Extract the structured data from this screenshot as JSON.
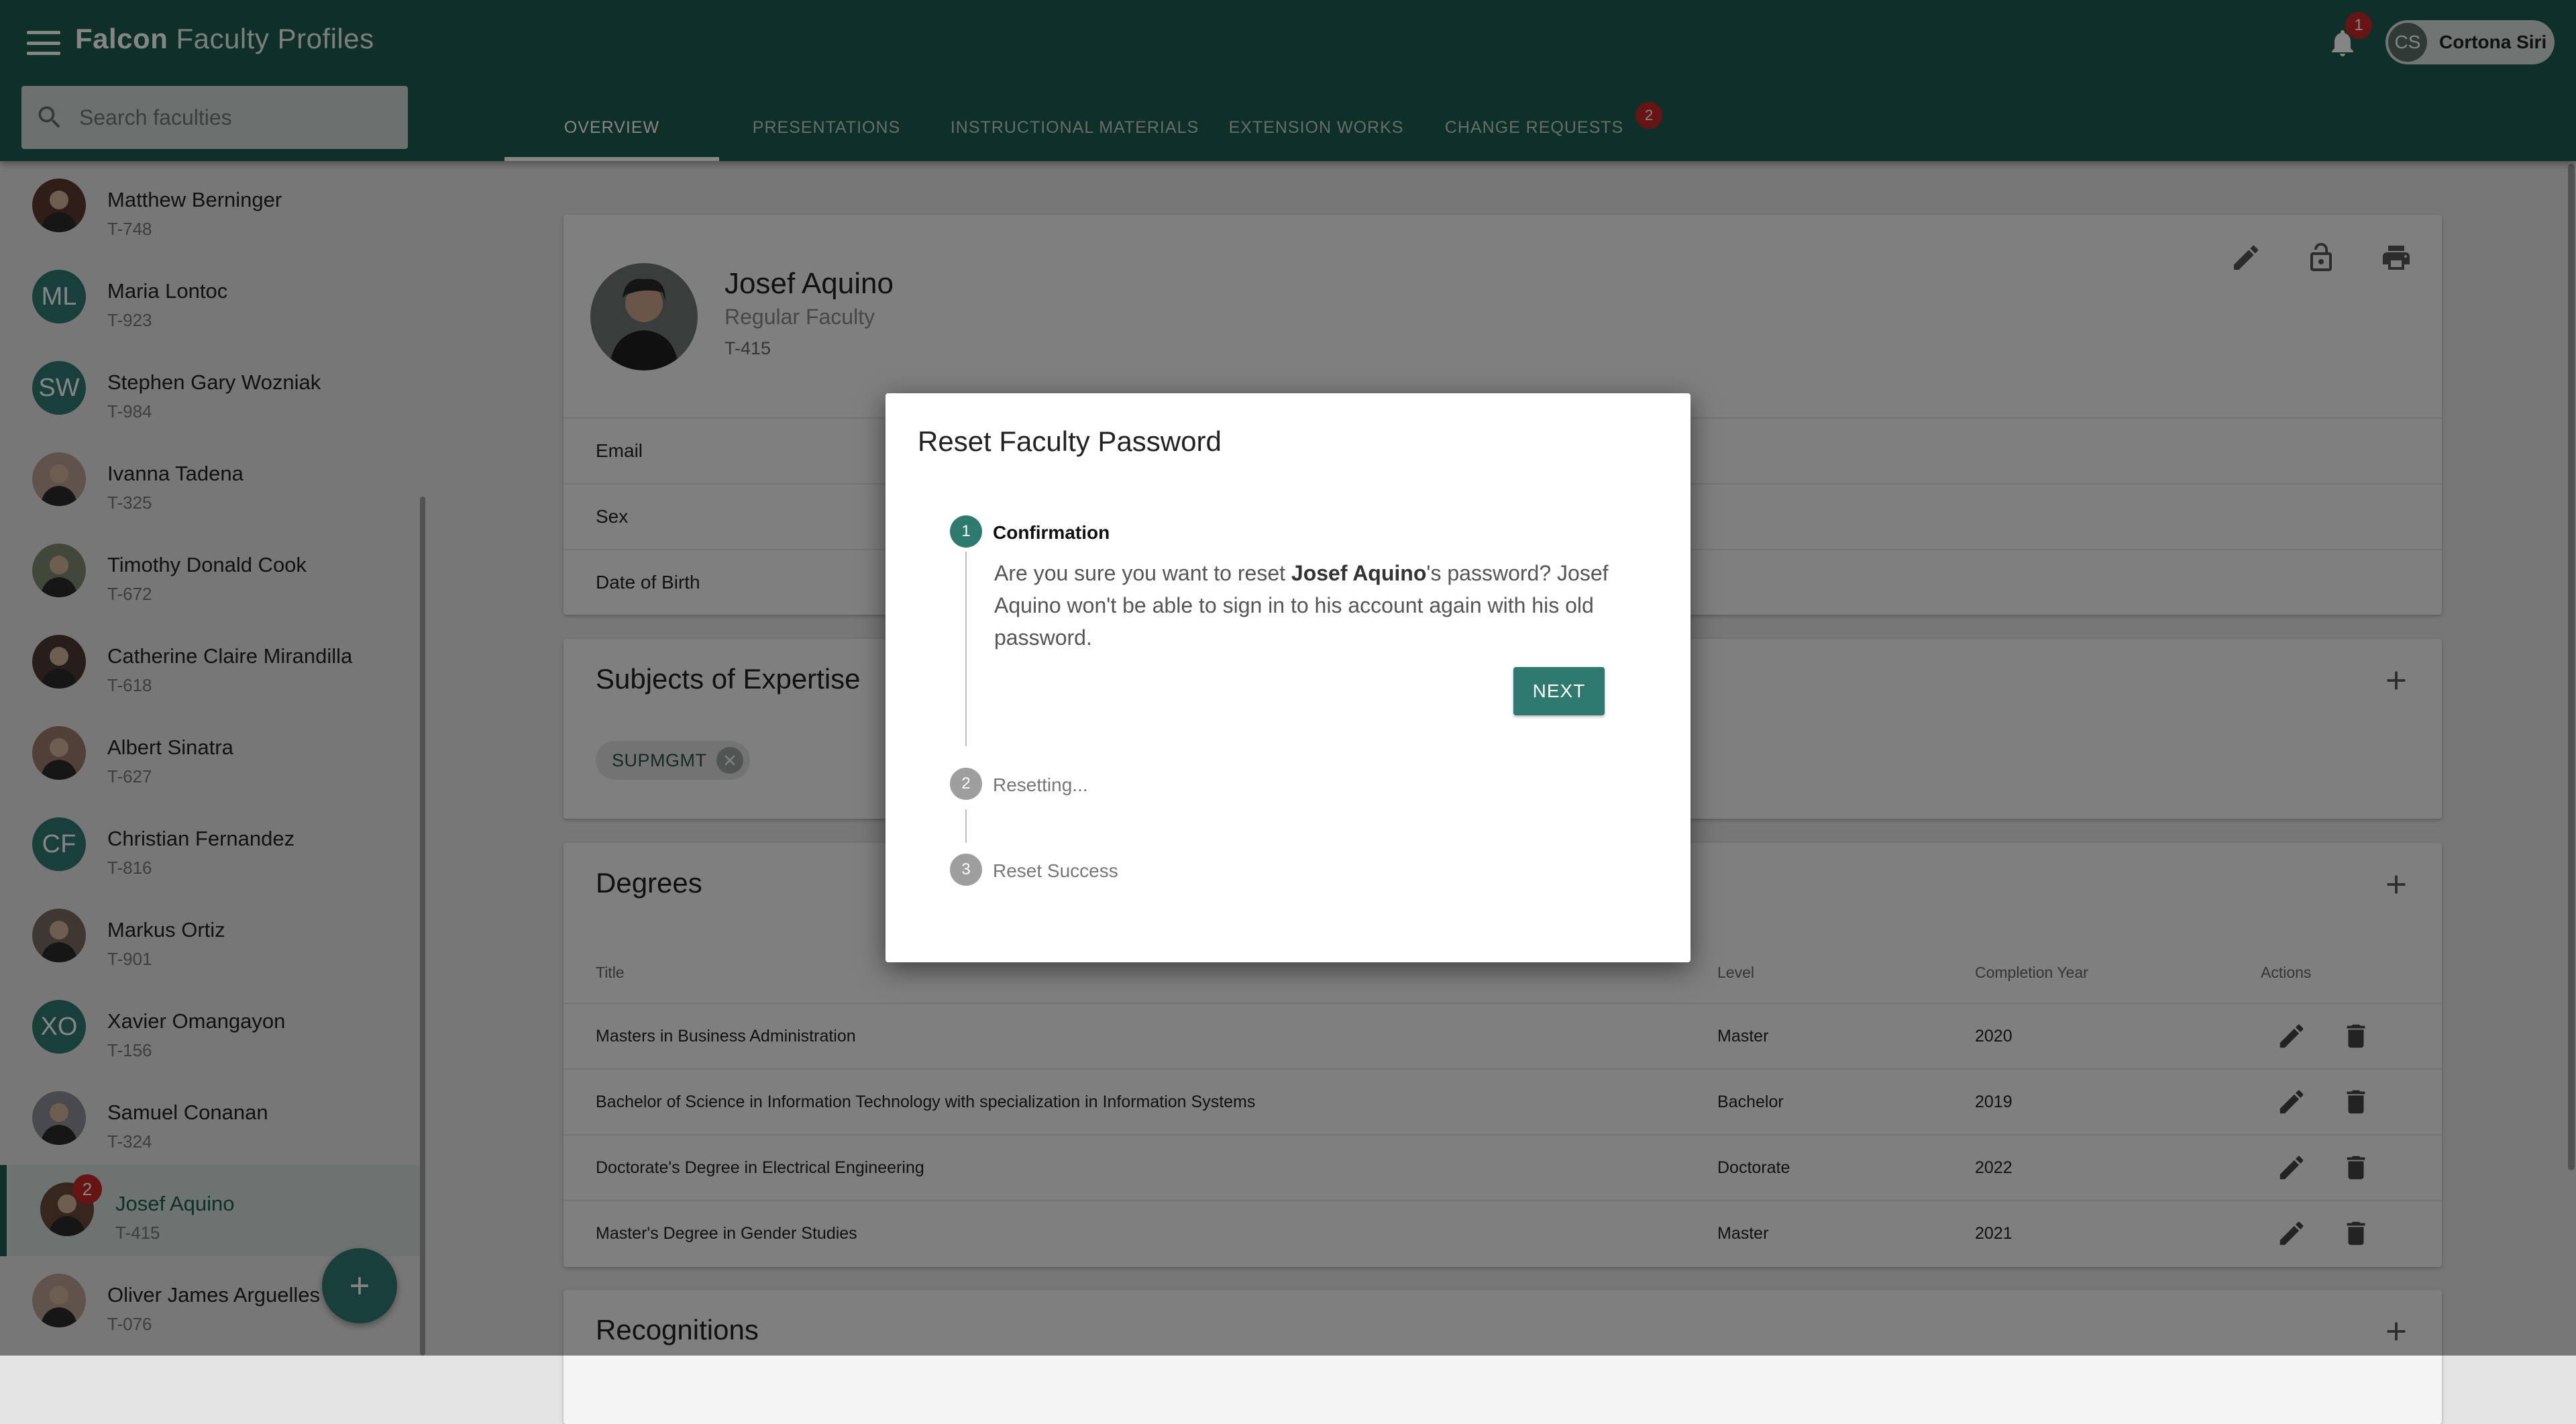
{
  "app": {
    "brand": "Falcon",
    "title_rest": "Faculty Profiles"
  },
  "notifications": {
    "count": "1"
  },
  "user": {
    "initials": "CS",
    "name": "Cortona Siri"
  },
  "search": {
    "placeholder": "Search faculties"
  },
  "tabs": [
    {
      "label": "OVERVIEW",
      "active": true
    },
    {
      "label": "PRESENTATIONS"
    },
    {
      "label": "INSTRUCTIONAL MATERIALS"
    },
    {
      "label": "EXTENSION WORKS"
    },
    {
      "label": "CHANGE REQUESTS",
      "badge": "2"
    }
  ],
  "faculties": [
    {
      "name": "Matthew Berninger",
      "id": "T-748",
      "avatar": "photo"
    },
    {
      "name": "Maria Lontoc",
      "id": "T-923",
      "initials": "ML"
    },
    {
      "name": "Stephen Gary Wozniak",
      "id": "T-984",
      "initials": "SW"
    },
    {
      "name": "Ivanna Tadena",
      "id": "T-325",
      "avatar": "photo"
    },
    {
      "name": "Timothy Donald Cook",
      "id": "T-672",
      "avatar": "photo"
    },
    {
      "name": "Catherine Claire Mirandilla",
      "id": "T-618",
      "avatar": "photo"
    },
    {
      "name": "Albert Sinatra",
      "id": "T-627",
      "avatar": "photo"
    },
    {
      "name": "Christian Fernandez",
      "id": "T-816",
      "initials": "CF"
    },
    {
      "name": "Markus Ortiz",
      "id": "T-901",
      "avatar": "photo"
    },
    {
      "name": "Xavier Omangayon",
      "id": "T-156",
      "initials": "XO"
    },
    {
      "name": "Samuel Conanan",
      "id": "T-324",
      "avatar": "photo"
    },
    {
      "name": "Josef Aquino",
      "id": "T-415",
      "avatar": "photo",
      "active": true,
      "badge": "2"
    },
    {
      "name": "Oliver James Arguelles",
      "id": "T-076",
      "avatar": "photo"
    }
  ],
  "profile": {
    "name": "Josef Aquino",
    "role": "Regular Faculty",
    "id": "T-415",
    "fields": [
      "Email",
      "Sex",
      "Date of Birth"
    ]
  },
  "expertise": {
    "title": "Subjects of Expertise",
    "chips": [
      "SUPMGMT"
    ]
  },
  "degrees": {
    "title": "Degrees",
    "columns": {
      "title": "Title",
      "level": "Level",
      "year": "Completion Year",
      "actions": "Actions"
    },
    "rows": [
      {
        "title": "Masters in Business Administration",
        "level": "Master",
        "year": "2020"
      },
      {
        "title": "Bachelor of Science in Information Technology with specialization in Information Systems",
        "level": "Bachelor",
        "year": "2019"
      },
      {
        "title": "Doctorate's Degree in Electrical Engineering",
        "level": "Doctorate",
        "year": "2022"
      },
      {
        "title": "Master's Degree in Gender Studies",
        "level": "Master",
        "year": "2021"
      }
    ]
  },
  "recognitions": {
    "title": "Recognitions"
  },
  "dialog": {
    "title": "Reset Faculty Password",
    "steps": [
      {
        "number": "1",
        "label": "Confirmation"
      },
      {
        "number": "2",
        "label": "Resetting..."
      },
      {
        "number": "3",
        "label": "Reset Success"
      }
    ],
    "message": {
      "prefix": "Are you sure you want to reset ",
      "name": "Josef Aquino",
      "suffix": "'s password? Josef Aquino won't be able to sign in to his account again with his old password."
    },
    "next_label": "NEXT"
  },
  "colors": {
    "primary": "#1e5a4f",
    "accent": "#2f7a6e",
    "badge": "#c62828"
  }
}
